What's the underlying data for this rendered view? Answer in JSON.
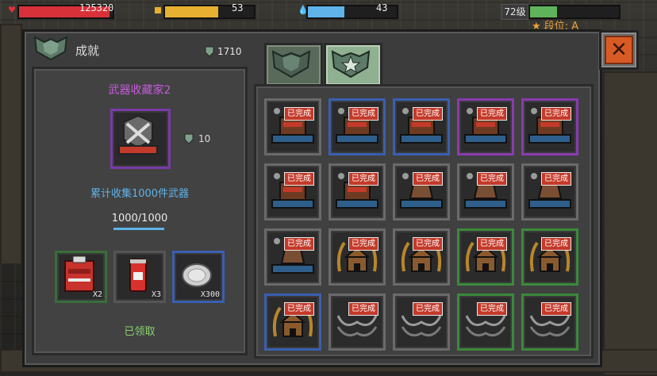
{
  "hud": {
    "health_value": "125320",
    "energy_value": "53",
    "mana_value": "43",
    "level_label": "72级",
    "rank_label": "段位: A",
    "health_fill": 0.97,
    "energy_fill": 0.6,
    "mana_fill": 0.41,
    "xp_fill": 0.3
  },
  "window": {
    "title": "成就",
    "currency_value": "1710"
  },
  "detail": {
    "title": "武器收藏家2",
    "reward_points": "10",
    "description": "累计收集1000件武器",
    "progress_text": "1000/1000",
    "rewards": [
      {
        "name": "red-backpack",
        "qty": "X2"
      },
      {
        "name": "cola-can",
        "qty": "X3"
      },
      {
        "name": "silver-coin",
        "qty": "X300"
      }
    ],
    "status": "已领取"
  },
  "tabs": [
    {
      "name": "tab-achievements",
      "active": false
    },
    {
      "name": "tab-star-achievements",
      "active": true
    }
  ],
  "grid": {
    "done_label": "已完成",
    "cells": [
      {
        "icon": "wrench-chest",
        "frame": "#6a6a6a"
      },
      {
        "icon": "wrench-chest",
        "frame": "#3a5fb0"
      },
      {
        "icon": "wrench-chest",
        "frame": "#3a5fb0"
      },
      {
        "icon": "wrench-chest",
        "frame": "#8a3ab0"
      },
      {
        "icon": "wrench-chest",
        "frame": "#8a3ab0"
      },
      {
        "icon": "wrench-chest",
        "frame": "#6a6a6a"
      },
      {
        "icon": "wrench-chest",
        "frame": "#6a6a6a"
      },
      {
        "icon": "wrench-bag",
        "frame": "#6a6a6a"
      },
      {
        "icon": "wrench-bag",
        "frame": "#6a6a6a"
      },
      {
        "icon": "wrench-bag",
        "frame": "#6a6a6a"
      },
      {
        "icon": "wrench-bag",
        "frame": "#6a6a6a"
      },
      {
        "icon": "wreath-house",
        "frame": "#6a6a6a"
      },
      {
        "icon": "wreath-house",
        "frame": "#6a6a6a"
      },
      {
        "icon": "wreath-house",
        "frame": "#3a8a3a"
      },
      {
        "icon": "wreath-house",
        "frame": "#3a8a3a"
      },
      {
        "icon": "wreath-house",
        "frame": "#3a5fb0"
      },
      {
        "icon": "chains",
        "frame": "#6a6a6a"
      },
      {
        "icon": "chains",
        "frame": "#6a6a6a"
      },
      {
        "icon": "chains",
        "frame": "#3a8a3a"
      },
      {
        "icon": "chains",
        "frame": "#3a8a3a"
      }
    ]
  }
}
